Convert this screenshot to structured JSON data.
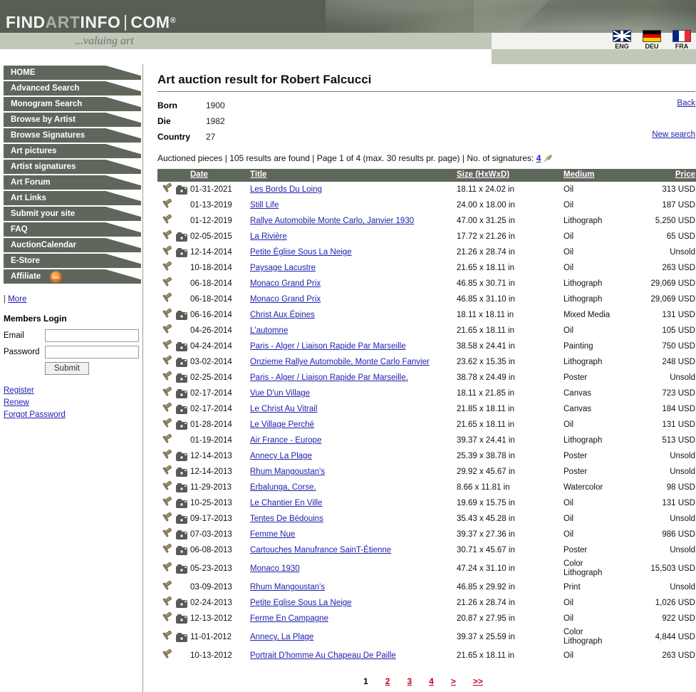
{
  "site": {
    "logo_part1": "FIND",
    "logo_part2": "ART",
    "logo_part3": "INFO",
    "logo_part4": "COM",
    "logo_reg": "®",
    "tagline": "...valuing art"
  },
  "languages": [
    {
      "code": "ENG",
      "icon": "uk-flag-icon"
    },
    {
      "code": "DEU",
      "icon": "germany-flag-icon"
    },
    {
      "code": "FRA",
      "icon": "france-flag-icon"
    }
  ],
  "sidebar": {
    "items": [
      {
        "label": "HOME",
        "badge": null
      },
      {
        "label": "Advanced Search",
        "badge": null
      },
      {
        "label": "Monogram Search",
        "badge": null
      },
      {
        "label": "Browse by Artist",
        "badge": null
      },
      {
        "label": "Browse Signatures",
        "badge": null
      },
      {
        "label": "Art pictures",
        "badge": null
      },
      {
        "label": "Artist signatures",
        "badge": null
      },
      {
        "label": "Art Forum",
        "badge": null
      },
      {
        "label": "Art Links",
        "badge": null
      },
      {
        "label": "Submit your site",
        "badge": null
      },
      {
        "label": "FAQ",
        "badge": null
      },
      {
        "label": "AuctionCalendar",
        "badge": null
      },
      {
        "label": "E-Store",
        "badge": null
      },
      {
        "label": "Affiliate",
        "badge": "new-badge-icon"
      }
    ],
    "more_prefix": "|",
    "more_label": "More",
    "login": {
      "title": "Members Login",
      "email_label": "Email",
      "email_value": "",
      "email_placeholder": "",
      "password_label": "Password",
      "password_value": "",
      "password_placeholder": "",
      "submit_label": "Submit"
    },
    "links": [
      "Register",
      "Renew",
      "Forgot Password"
    ]
  },
  "main": {
    "page_title": "Art auction result for Robert Falcucci",
    "bio": [
      {
        "key": "Born",
        "value": "1900"
      },
      {
        "key": "Die",
        "value": "1982"
      },
      {
        "key": "Country",
        "value": "27"
      }
    ],
    "back_label": "Back",
    "new_search_label": "New search",
    "summary": {
      "part1": "Auctioned pieces",
      "sep": " | ",
      "part2": "105 results are found",
      "part3": "Page 1 of 4 (max. 30 results pr. page)",
      "part4": "No. of signatures:",
      "signatures_count": "4",
      "signature_icon": "quill-icon"
    },
    "table": {
      "headers": {
        "icons": "",
        "date": "Date",
        "title": "Title",
        "size": "Size (HxWxD)",
        "medium": "Medium",
        "price": "Price"
      },
      "rows": [
        {
          "gavel": true,
          "camera": true,
          "date": "01-31-2021",
          "title": "Les Bords Du Loing",
          "size": "18.11 x 24.02 in",
          "medium": "Oil",
          "price": "313 USD"
        },
        {
          "gavel": true,
          "camera": false,
          "date": "01-13-2019",
          "title": "Still Life",
          "size": "24.00 x 18.00 in",
          "medium": "Oil",
          "price": "187 USD"
        },
        {
          "gavel": true,
          "camera": false,
          "date": "01-12-2019",
          "title": "Rallye Automobile Monte Carlo, Janvier 1930",
          "size": "47.00 x 31.25 in",
          "medium": "Lithograph",
          "price": "5,250 USD"
        },
        {
          "gavel": true,
          "camera": true,
          "date": "02-05-2015",
          "title": "La Rivière",
          "size": "17.72 x 21.26 in",
          "medium": "Oil",
          "price": "65 USD"
        },
        {
          "gavel": true,
          "camera": true,
          "date": "12-14-2014",
          "title": "Petite Église Sous La Neige",
          "size": "21.26 x 28.74 in",
          "medium": "Oil",
          "price": "Unsold"
        },
        {
          "gavel": true,
          "camera": false,
          "date": "10-18-2014",
          "title": "Paysage Lacustre",
          "size": "21.65 x 18.11 in",
          "medium": "Oil",
          "price": "263 USD"
        },
        {
          "gavel": true,
          "camera": false,
          "date": "06-18-2014",
          "title": "Monaco Grand Prix",
          "size": "46.85 x 30.71 in",
          "medium": "Lithograph",
          "price": "29,069 USD"
        },
        {
          "gavel": true,
          "camera": false,
          "date": "06-18-2014",
          "title": "Monaco Grand Prix",
          "size": "46.85 x 31.10 in",
          "medium": "Lithograph",
          "price": "29,069 USD"
        },
        {
          "gavel": true,
          "camera": true,
          "date": "06-16-2014",
          "title": "Christ Aux Épines",
          "size": "18.11 x 18.11 in",
          "medium": "Mixed Media",
          "price": "131 USD"
        },
        {
          "gavel": true,
          "camera": false,
          "date": "04-26-2014",
          "title": "L'automne",
          "size": "21.65 x 18.11 in",
          "medium": "Oil",
          "price": "105 USD"
        },
        {
          "gavel": true,
          "camera": true,
          "date": "04-24-2014",
          "title": "Paris - Alger / Liaison Rapide Par Marseille",
          "size": "38.58 x 24.41 in",
          "medium": "Painting",
          "price": "750 USD"
        },
        {
          "gavel": true,
          "camera": true,
          "date": "03-02-2014",
          "title": "Onzieme Rallye Automobile, Monte Carlo Fanvier",
          "size": "23.62 x 15.35 in",
          "medium": "Lithograph",
          "price": "248 USD"
        },
        {
          "gavel": true,
          "camera": true,
          "date": "02-25-2014",
          "title": "Paris - Alger / Liaison Rapide Par Marseille.",
          "size": "38.78 x 24.49 in",
          "medium": "Poster",
          "price": "Unsold"
        },
        {
          "gavel": true,
          "camera": true,
          "date": "02-17-2014",
          "title": "Vue D'un Village",
          "size": "18.11 x 21.85 in",
          "medium": "Canvas",
          "price": "723 USD"
        },
        {
          "gavel": true,
          "camera": true,
          "date": "02-17-2014",
          "title": "Le Christ Au Vitrail",
          "size": "21.85 x 18.11 in",
          "medium": "Canvas",
          "price": "184 USD"
        },
        {
          "gavel": true,
          "camera": true,
          "date": "01-28-2014",
          "title": "Le Village Perché",
          "size": "21.65 x 18.11 in",
          "medium": "Oil",
          "price": "131 USD"
        },
        {
          "gavel": true,
          "camera": false,
          "date": "01-19-2014",
          "title": "Air France - Europe",
          "size": "39.37 x 24.41 in",
          "medium": "Lithograph",
          "price": "513 USD"
        },
        {
          "gavel": true,
          "camera": true,
          "date": "12-14-2013",
          "title": "Annecy La Plage",
          "size": "25.39 x 38.78 in",
          "medium": "Poster",
          "price": "Unsold"
        },
        {
          "gavel": true,
          "camera": true,
          "date": "12-14-2013",
          "title": "Rhum Mangoustan's",
          "size": "29.92 x 45.67 in",
          "medium": "Poster",
          "price": "Unsold"
        },
        {
          "gavel": true,
          "camera": true,
          "date": "11-29-2013",
          "title": "Erbalunga, Corse.",
          "size": "8.66 x 11.81 in",
          "medium": "Watercolor",
          "price": "98 USD"
        },
        {
          "gavel": true,
          "camera": true,
          "date": "10-25-2013",
          "title": "Le Chantier En Ville",
          "size": "19.69 x 15.75 in",
          "medium": "Oil",
          "price": "131 USD"
        },
        {
          "gavel": true,
          "camera": true,
          "date": "09-17-2013",
          "title": "Tentes De Bédouins",
          "size": "35.43 x 45.28 in",
          "medium": "Oil",
          "price": "Unsold"
        },
        {
          "gavel": true,
          "camera": true,
          "date": "07-03-2013",
          "title": "Femme Nue",
          "size": "39.37 x 27.36 in",
          "medium": "Oil",
          "price": "986 USD"
        },
        {
          "gavel": true,
          "camera": true,
          "date": "06-08-2013",
          "title": "Cartouches Manufrance SainT-Étienne",
          "size": "30.71 x 45.67 in",
          "medium": "Poster",
          "price": "Unsold"
        },
        {
          "gavel": true,
          "camera": true,
          "date": "05-23-2013",
          "title": "Monaco 1930",
          "size": "47.24 x 31.10 in",
          "medium": "Color Lithograph",
          "price": "15,503 USD"
        },
        {
          "gavel": true,
          "camera": false,
          "date": "03-09-2013",
          "title": "Rhum Mangoustan's",
          "size": "46.85 x 29.92 in",
          "medium": "Print",
          "price": "Unsold"
        },
        {
          "gavel": true,
          "camera": true,
          "date": "02-24-2013",
          "title": "Petite Eglise Sous La Neige",
          "size": "21.26 x 28.74 in",
          "medium": "Oil",
          "price": "1,026 USD"
        },
        {
          "gavel": true,
          "camera": true,
          "date": "12-13-2012",
          "title": "Ferme En Campagne",
          "size": "20.87 x 27.95 in",
          "medium": "Oil",
          "price": "922 USD"
        },
        {
          "gavel": true,
          "camera": true,
          "date": "11-01-2012",
          "title": "Annecy, La Plage",
          "size": "39.37 x 25.59 in",
          "medium": "Color Lithograph",
          "price": "4,844 USD"
        },
        {
          "gavel": true,
          "camera": false,
          "date": "10-13-2012",
          "title": "Portrait D'homme Au Chapeau De Paille",
          "size": "21.65 x 18.11 in",
          "medium": "Oil",
          "price": "263 USD"
        }
      ]
    },
    "pagination": {
      "current": "1",
      "links": [
        "2",
        "3",
        "4",
        ">",
        ">>"
      ]
    }
  },
  "colors": {
    "header_bg": "#575f55",
    "band_bg": "#c1c8ba",
    "nav_bg": "#5f675d",
    "link": "#2020b0",
    "pager_link": "#c00020",
    "badge": "#f07818"
  }
}
